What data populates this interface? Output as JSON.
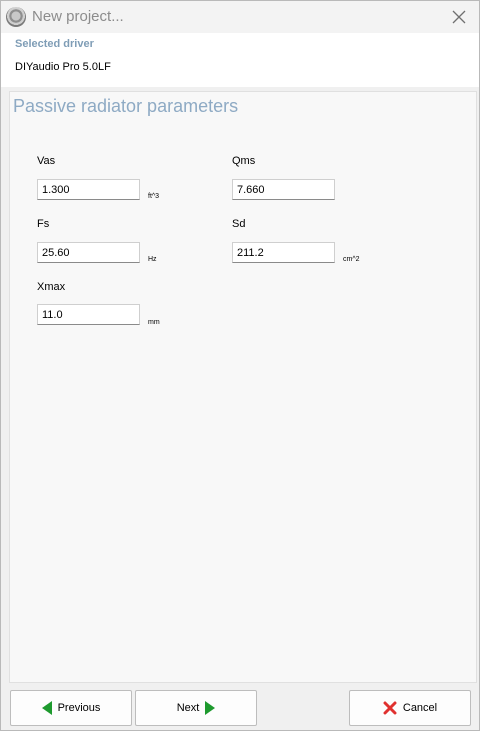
{
  "window": {
    "title": "New project..."
  },
  "driver": {
    "heading": "Selected driver",
    "name": "DIYaudio Pro 5.0LF"
  },
  "params": {
    "title": "Passive radiator parameters",
    "vas": {
      "label": "Vas",
      "value": "1.300",
      "unit": "ft^3"
    },
    "qms": {
      "label": "Qms",
      "value": "7.660"
    },
    "fs": {
      "label": "Fs",
      "value": "25.60",
      "unit": "Hz"
    },
    "sd": {
      "label": "Sd",
      "value": "211.2",
      "unit": "cm^2"
    },
    "xmax": {
      "label": "Xmax",
      "value": "11.0",
      "unit": "mm"
    }
  },
  "buttons": {
    "previous": "Previous",
    "next": "Next",
    "cancel": "Cancel"
  },
  "colors": {
    "accent_text": "#8eaac4",
    "arrow_green": "#1e9a2e",
    "cancel_red": "#e0312f"
  },
  "icons": {
    "app": "speaker-icon",
    "close": "close-icon",
    "previous": "arrow-left-icon",
    "next": "arrow-right-icon",
    "cancel": "x-icon"
  }
}
